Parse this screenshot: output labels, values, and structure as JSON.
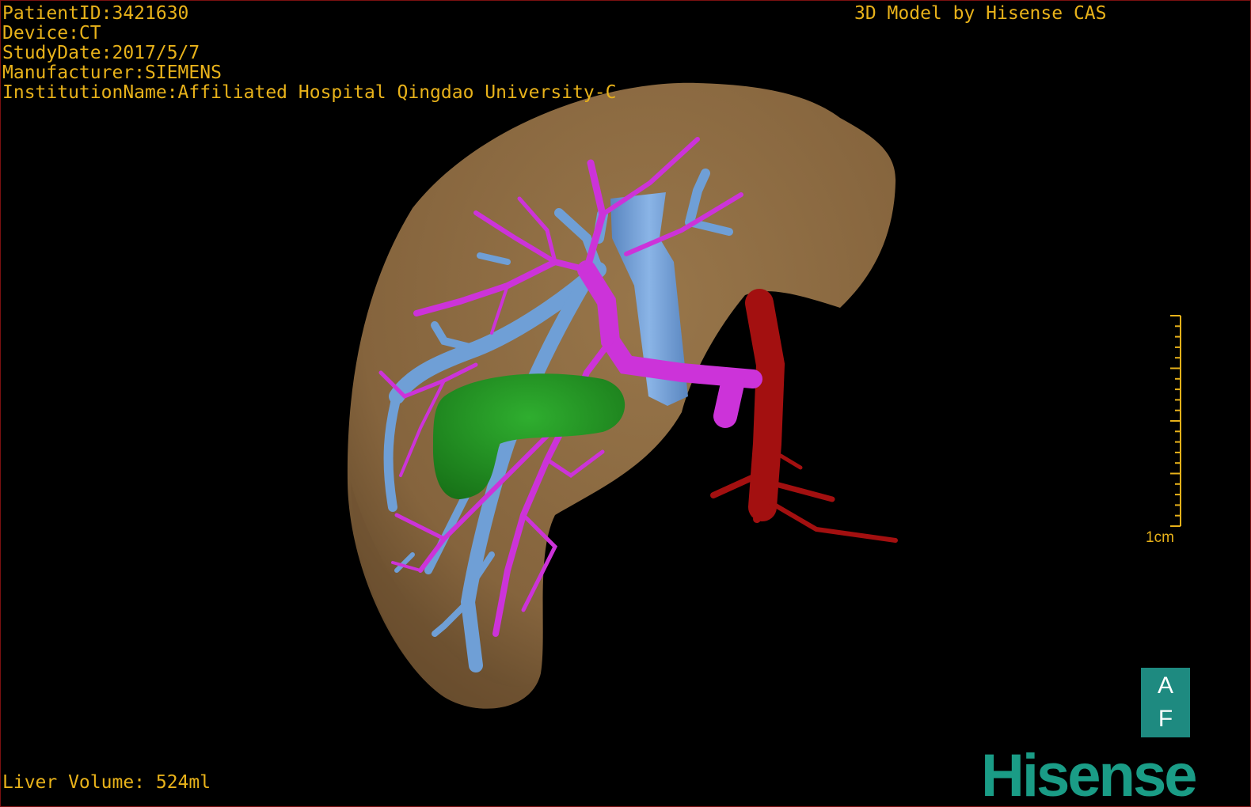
{
  "overlay": {
    "patient_id": "PatientID:3421630",
    "device": "Device:CT",
    "study_date": "StudyDate:2017/5/7",
    "manufacturer": "Manufacturer:SIEMENS",
    "institution": "InstitutionName:Affiliated Hospital Qingdao University-C",
    "model_credit": "3D Model by Hisense CAS",
    "liver_volume": "Liver Volume: 524ml"
  },
  "scale_bar": {
    "label": "1cm"
  },
  "orientation": {
    "top": "A",
    "bottom": "F"
  },
  "brand": "Hisense",
  "colors": {
    "text": "#e8b21a",
    "liver": "#87673f",
    "portal_vein": "#cc33d9",
    "hepatic_vein": "#6f9fd6",
    "artery": "#a31010",
    "lesion": "#1f8a1f",
    "orientation_box": "#1e8a80",
    "brand": "#1a9c86"
  }
}
